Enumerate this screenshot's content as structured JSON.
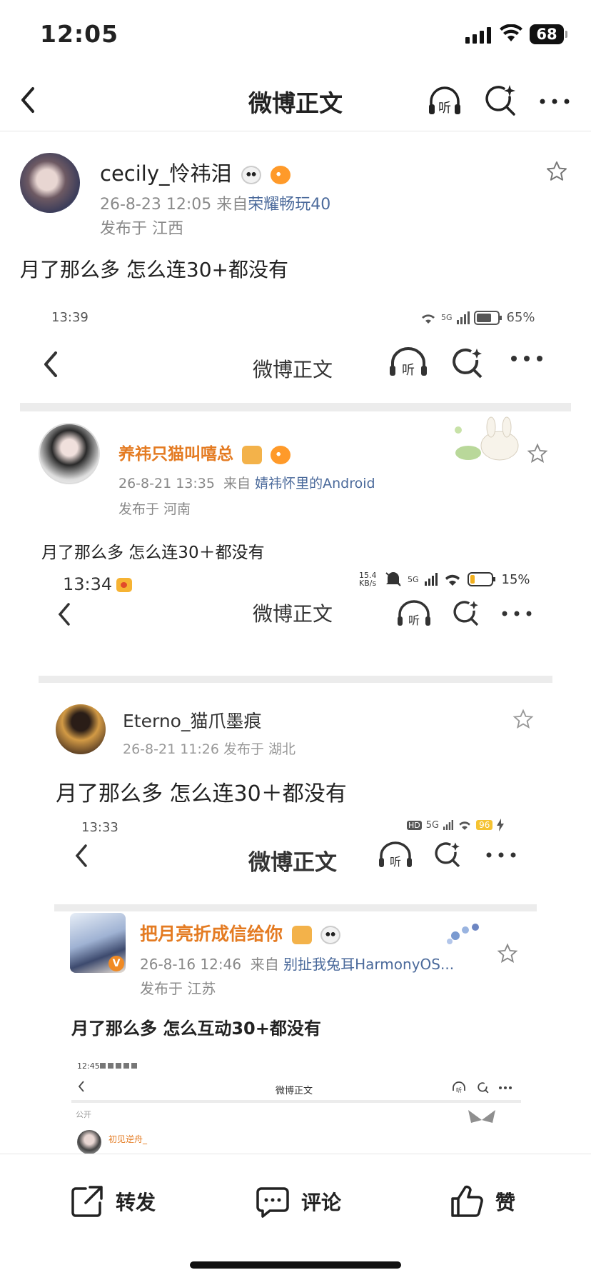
{
  "status_bar": {
    "time": "12:05",
    "battery": "68"
  },
  "nav": {
    "title": "微博正文",
    "listen_icon_text": "听"
  },
  "post": {
    "username": "cecily_怜祎泪",
    "date": "26-8-23 12:05",
    "from_prefix": "来自",
    "source": "荣耀畅玩40",
    "location": "发布于 江西",
    "text": "月了那么多 怎么连30+都没有"
  },
  "shot1": {
    "time": "13:39",
    "battery": "65%",
    "signal": "5G",
    "nav_title": "微博正文",
    "listen": "听",
    "username": "养祎只猫叫嘻总",
    "date": "26-8-21 13:35",
    "from_prefix": "来自",
    "source": "婧祎怀里的Android",
    "location": "发布于 河南",
    "text": "月了那么多 怎么连30＋都没有"
  },
  "shot2": {
    "time": "13:34",
    "net_speed": "15.4 KB/s",
    "signal": "5G",
    "battery": "15%",
    "nav_title": "微博正文",
    "listen": "听",
    "username": "Eterno_猫爪墨痕",
    "meta": "26-8-21 11:26  发布于 湖北",
    "text": "月了那么多 怎么连30＋都没有"
  },
  "shot3": {
    "time": "13:33",
    "hd": "HD",
    "signal": "5G",
    "battery": "96",
    "nav_title": "微博正文",
    "listen": "听",
    "username": "把月亮折成信给你",
    "date": "26-8-16 12:46",
    "from_prefix": "来自",
    "source": "别扯我兔耳HarmonyOS...",
    "location": "发布于 江苏",
    "text": "月了那么多 怎么互动30+都没有",
    "badge": "V"
  },
  "shot4": {
    "time": "12:45",
    "nav_title": "微博正文",
    "listen": "听",
    "public_label": "公开",
    "username": "初见逆舟_"
  },
  "actions": {
    "repost": "转发",
    "comment": "评论",
    "like": "赞"
  },
  "icons": {
    "back": "chevron-left-icon",
    "listen": "headphones-icon",
    "search": "sparkle-search-icon",
    "more": "more-horizontal-icon",
    "star": "star-outline-icon",
    "repost": "share-icon",
    "comment": "comment-icon",
    "like": "thumbs-up-icon"
  }
}
